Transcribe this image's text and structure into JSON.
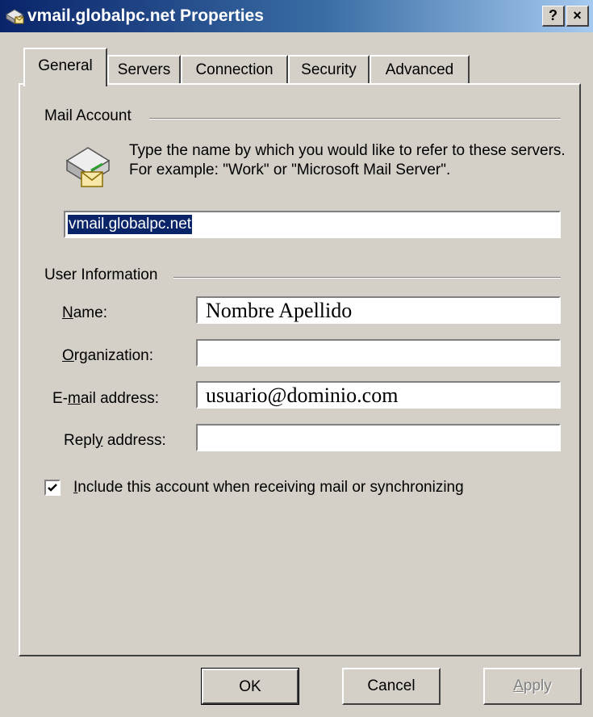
{
  "window": {
    "title": "vmail.globalpc.net Properties",
    "help_button": "?",
    "close_button": "×"
  },
  "tabs": [
    {
      "label": "General",
      "active": true
    },
    {
      "label": "Servers",
      "active": false
    },
    {
      "label": "Connection",
      "active": false
    },
    {
      "label": "Security",
      "active": false
    },
    {
      "label": "Advanced",
      "active": false
    }
  ],
  "mail_account": {
    "group_label": "Mail Account",
    "description": "Type the name by which you would like to refer to these servers.  For example: \"Work\" or \"Microsoft Mail Server\".",
    "account_name": "vmail.globalpc.net",
    "icon": "mail-server-icon"
  },
  "user_information": {
    "group_label": "User Information",
    "name_label_key": "N",
    "name_label_rest": "ame:",
    "name_value": "Nombre Apellido",
    "organization_label_key": "O",
    "organization_label_rest": "rganization:",
    "organization_value": "",
    "email_label_pre": "E-",
    "email_label_key": "m",
    "email_label_rest": "ail address:",
    "email_value": "usuario@dominio.com",
    "reply_label_pre": "Repl",
    "reply_label_key": "y",
    "reply_label_rest": " address:",
    "reply_value": ""
  },
  "include_checkbox": {
    "key": "I",
    "rest": "nclude this account when receiving mail or synchronizing",
    "checked": true
  },
  "buttons": {
    "ok": "OK",
    "cancel": "Cancel",
    "apply_key": "A",
    "apply_rest": "pply"
  },
  "colors": {
    "title_bar_start": "#0a246a",
    "title_bar_end": "#a6caf0",
    "selection": "#0a246a",
    "face": "#d4d0c8",
    "disabled_text": "#808080"
  }
}
